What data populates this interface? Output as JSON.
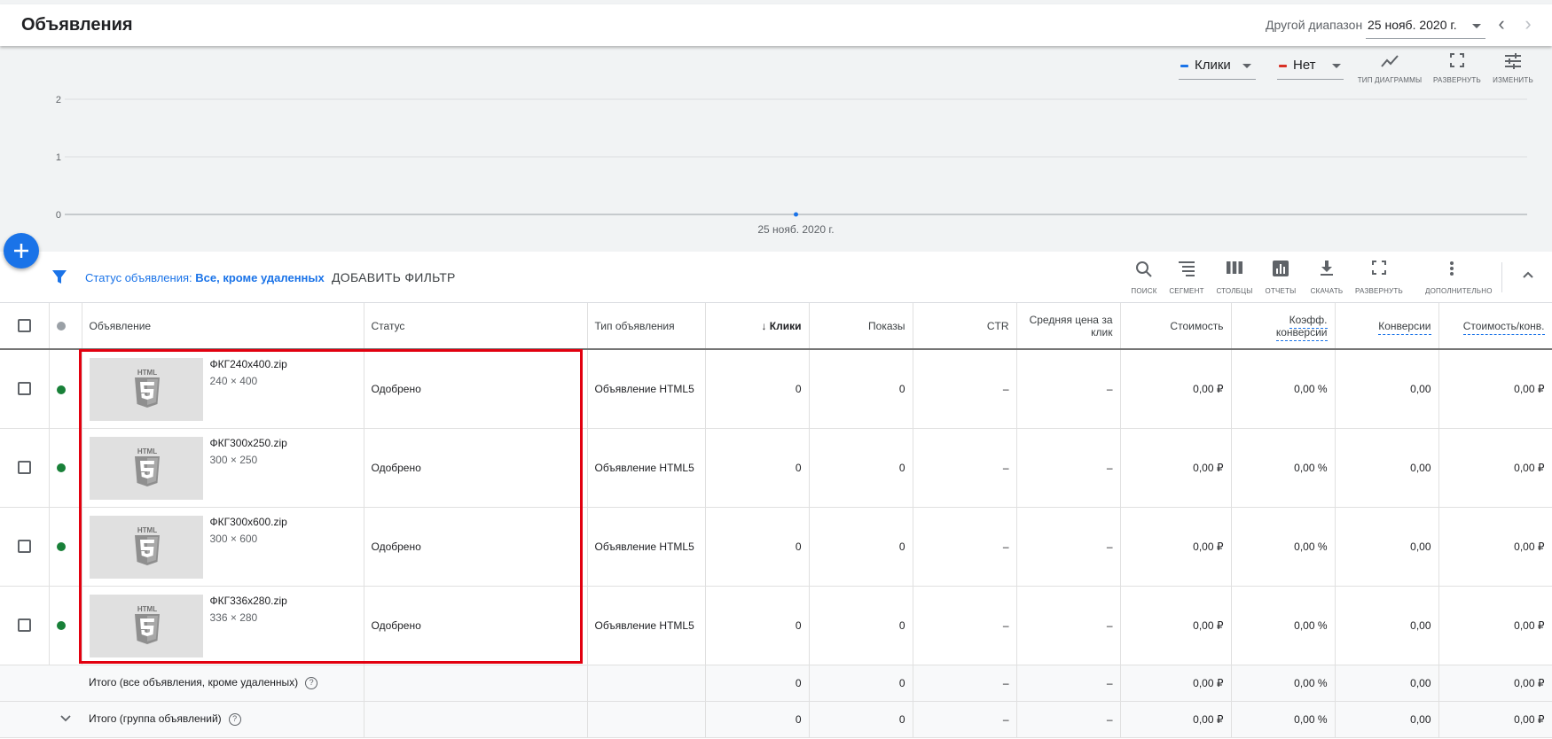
{
  "header": {
    "title": "Объявления",
    "range_label": "Другой диапазон",
    "date_value": "25 нояб. 2020 г."
  },
  "chart_toolbar": {
    "metric1": {
      "label": "Клики",
      "color": "#1a73e8"
    },
    "metric2": {
      "label": "Нет",
      "color": "#d93025"
    },
    "chart_type": "ТИП ДИАГРАММЫ",
    "expand": "РАЗВЕРНУТЬ",
    "edit": "ИЗМЕНИТЬ"
  },
  "chart_data": {
    "type": "line",
    "x": [
      "25 нояб. 2020 г."
    ],
    "series": [
      {
        "name": "Клики",
        "values": [
          0
        ],
        "color": "#1a73e8"
      }
    ],
    "ylim": [
      0,
      2
    ],
    "yticks": [
      "0",
      "1",
      "2"
    ],
    "grid": true
  },
  "filter": {
    "label": "Статус объявления: ",
    "value": "Все, кроме удаленных",
    "add": "ДОБАВИТЬ ФИЛЬТР"
  },
  "toolbar": {
    "search": "ПОИСК",
    "segment": "СЕГМЕНТ",
    "columns": "СТОЛБЦЫ",
    "reports": "ОТЧЕТЫ",
    "download": "СКАЧАТЬ",
    "expand": "РАЗВЕРНУТЬ",
    "more": "ДОПОЛНИТЕЛЬНО"
  },
  "table": {
    "headers": {
      "ad": "Объявление",
      "status": "Статус",
      "type": "Тип объявления",
      "clicks": "Клики",
      "impressions": "Показы",
      "ctr": "CTR",
      "avg_cpc": "Средняя цена за клик",
      "cost": "Стоимость",
      "conv_rate": "Коэфф. конверсии",
      "conversions": "Конверсии",
      "cost_conv": "Стоимость/конв."
    },
    "rows": [
      {
        "name": "ФКГ240x400.zip",
        "size": "240 × 400",
        "status": "Одобрено",
        "type": "Объявление HTML5",
        "clicks": "0",
        "impressions": "0",
        "ctr": "–",
        "avg_cpc": "–",
        "cost": "0,00 ₽",
        "conv_rate": "0,00 %",
        "conversions": "0,00",
        "cost_conv": "0,00 ₽"
      },
      {
        "name": "ФКГ300x250.zip",
        "size": "300 × 250",
        "status": "Одобрено",
        "type": "Объявление HTML5",
        "clicks": "0",
        "impressions": "0",
        "ctr": "–",
        "avg_cpc": "–",
        "cost": "0,00 ₽",
        "conv_rate": "0,00 %",
        "conversions": "0,00",
        "cost_conv": "0,00 ₽"
      },
      {
        "name": "ФКГ300x600.zip",
        "size": "300 × 600",
        "status": "Одобрено",
        "type": "Объявление HTML5",
        "clicks": "0",
        "impressions": "0",
        "ctr": "–",
        "avg_cpc": "–",
        "cost": "0,00 ₽",
        "conv_rate": "0,00 %",
        "conversions": "0,00",
        "cost_conv": "0,00 ₽"
      },
      {
        "name": "ФКГ336x280.zip",
        "size": "336 × 280",
        "status": "Одобрено",
        "type": "Объявление HTML5",
        "clicks": "0",
        "impressions": "0",
        "ctr": "–",
        "avg_cpc": "–",
        "cost": "0,00 ₽",
        "conv_rate": "0,00 %",
        "conversions": "0,00",
        "cost_conv": "0,00 ₽"
      }
    ],
    "totals": [
      {
        "label": "Итого (все объявления, кроме удаленных)",
        "clicks": "0",
        "impressions": "0",
        "ctr": "–",
        "avg_cpc": "–",
        "cost": "0,00 ₽",
        "conv_rate": "0,00 %",
        "conversions": "0,00",
        "cost_conv": "0,00 ₽"
      },
      {
        "label": "Итого (группа объявлений)",
        "clicks": "0",
        "impressions": "0",
        "ctr": "–",
        "avg_cpc": "–",
        "cost": "0,00 ₽",
        "conv_rate": "0,00 %",
        "conversions": "0,00",
        "cost_conv": "0,00 ₽"
      }
    ]
  },
  "thumbnail_text": "HTML"
}
